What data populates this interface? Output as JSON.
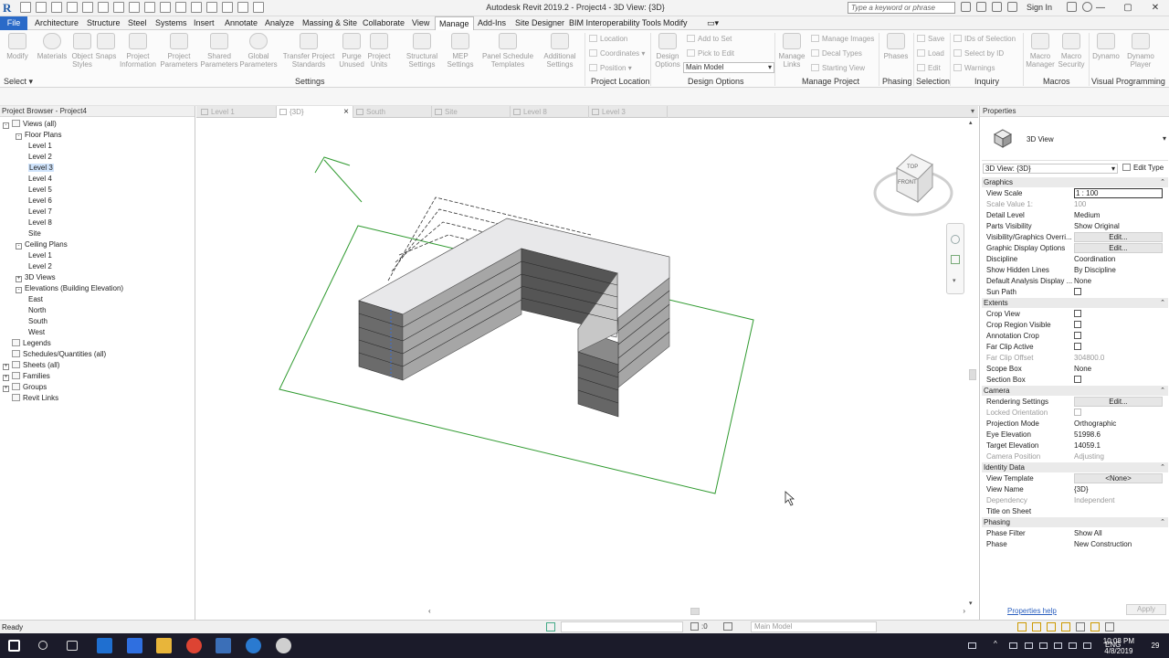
{
  "window": {
    "title": "Autodesk Revit 2019.2 - Project4 - 3D View: {3D}",
    "search_placeholder": "Type a keyword or phrase",
    "sign_in": "Sign In"
  },
  "menu_tabs": [
    "File",
    "Architecture",
    "Structure",
    "Steel",
    "Systems",
    "Insert",
    "Annotate",
    "Analyze",
    "Massing & Site",
    "Collaborate",
    "View",
    "Manage",
    "Add-Ins",
    "Site Designer",
    "BIM Interoperability Tools",
    "Modify"
  ],
  "active_tab": "Manage",
  "ribbon": {
    "select_label": "Select",
    "buttons": [
      {
        "label": "Modify",
        "icon": "cursor-icon"
      },
      {
        "label": "Materials",
        "icon": "sphere-icon"
      },
      {
        "label": "Object Styles",
        "icon": "object-styles-icon"
      },
      {
        "label": "Snaps",
        "icon": "magnet-icon"
      },
      {
        "label": "Project Information",
        "icon": "info-icon"
      },
      {
        "label": "Project Parameters",
        "icon": "parameters-icon"
      },
      {
        "label": "Shared Parameters",
        "icon": "shared-parameters-icon"
      },
      {
        "label": "Global Parameters",
        "icon": "globe-icon"
      },
      {
        "label": "Transfer Project Standards",
        "icon": "transfer-icon"
      },
      {
        "label": "Purge Unused",
        "icon": "purge-icon"
      },
      {
        "label": "Project Units",
        "icon": "units-icon"
      },
      {
        "label": "Structural Settings",
        "icon": "structural-settings-icon"
      },
      {
        "label": "MEP Settings",
        "icon": "mep-settings-icon"
      },
      {
        "label": "Panel Schedule Templates",
        "icon": "panel-schedule-icon"
      },
      {
        "label": "Additional Settings",
        "icon": "wrench-icon"
      },
      {
        "label": "Design Options",
        "icon": "design-options-icon"
      },
      {
        "label": "Manage Links",
        "icon": "links-icon"
      },
      {
        "label": "Phases",
        "icon": "phases-icon"
      },
      {
        "label": "Macro Manager",
        "icon": "macro-manager-icon"
      },
      {
        "label": "Macro Security",
        "icon": "macro-security-icon"
      },
      {
        "label": "Dynamo",
        "icon": "dynamo-icon"
      },
      {
        "label": "Dynamo Player",
        "icon": "dynamo-player-icon"
      }
    ],
    "small_items": {
      "location": [
        "Location",
        "Coordinates",
        "Position"
      ],
      "design_options": [
        "Add to Set",
        "Pick to Edit"
      ],
      "design_option_value": "Main Model",
      "manage_project": [
        "Manage Images",
        "Decal Types",
        "Starting View"
      ],
      "selection": [
        "Save",
        "Load",
        "Edit"
      ],
      "inquiry": [
        "IDs of Selection",
        "Select by ID",
        "Warnings"
      ]
    },
    "panels": [
      "Settings",
      "Project Location",
      "Design Options",
      "Manage Project",
      "Phasing",
      "Selection",
      "Inquiry",
      "Macros",
      "Visual Programming"
    ]
  },
  "project_browser": {
    "title": "Project Browser - Project4",
    "nodes": [
      {
        "label": "Views (all)",
        "level": 0,
        "exp": "-",
        "icon": true
      },
      {
        "label": "Floor Plans",
        "level": 1,
        "exp": "-"
      },
      {
        "label": "Level 1",
        "level": 2
      },
      {
        "label": "Level 2",
        "level": 2
      },
      {
        "label": "Level 3",
        "level": 2,
        "selected": true
      },
      {
        "label": "Level 4",
        "level": 2
      },
      {
        "label": "Level 5",
        "level": 2
      },
      {
        "label": "Level 6",
        "level": 2
      },
      {
        "label": "Level 7",
        "level": 2
      },
      {
        "label": "Level 8",
        "level": 2
      },
      {
        "label": "Site",
        "level": 2
      },
      {
        "label": "Ceiling Plans",
        "level": 1,
        "exp": "-"
      },
      {
        "label": "Level 1",
        "level": 2
      },
      {
        "label": "Level 2",
        "level": 2
      },
      {
        "label": "3D Views",
        "level": 1,
        "exp": "+"
      },
      {
        "label": "Elevations (Building Elevation)",
        "level": 1,
        "exp": "-"
      },
      {
        "label": "East",
        "level": 2
      },
      {
        "label": "North",
        "level": 2
      },
      {
        "label": "South",
        "level": 2
      },
      {
        "label": "West",
        "level": 2
      },
      {
        "label": "Legends",
        "level": 0,
        "icon": true
      },
      {
        "label": "Schedules/Quantities (all)",
        "level": 0,
        "icon": true
      },
      {
        "label": "Sheets (all)",
        "level": 0,
        "exp": "+",
        "icon": true
      },
      {
        "label": "Families",
        "level": 0,
        "exp": "+",
        "icon": true
      },
      {
        "label": "Groups",
        "level": 0,
        "exp": "+",
        "icon": true
      },
      {
        "label": "Revit Links",
        "level": 0,
        "icon": true
      }
    ]
  },
  "view_tabs": [
    {
      "label": "Level 1",
      "active": false
    },
    {
      "label": "{3D}",
      "active": true
    },
    {
      "label": "South",
      "active": false
    },
    {
      "label": "Site",
      "active": false
    },
    {
      "label": "Level 8",
      "active": false
    },
    {
      "label": "Level 3",
      "active": false
    }
  ],
  "viewcube": {
    "top": "TOP",
    "front": "FRONT"
  },
  "properties": {
    "title": "Properties",
    "type_name": "3D View",
    "instance": "3D View: {3D}",
    "edit_type": "Edit Type",
    "help": "Properties help",
    "apply": "Apply",
    "groups": [
      {
        "name": "Graphics",
        "rows": [
          {
            "k": "View Scale",
            "v": "1 : 100",
            "style": "box"
          },
          {
            "k": "Scale Value    1:",
            "v": "100",
            "dim": true
          },
          {
            "k": "Detail Level",
            "v": "Medium"
          },
          {
            "k": "Parts Visibility",
            "v": "Show Original"
          },
          {
            "k": "Visibility/Graphics Overri...",
            "v": "Edit...",
            "style": "btn"
          },
          {
            "k": "Graphic Display Options",
            "v": "Edit...",
            "style": "btn"
          },
          {
            "k": "Discipline",
            "v": "Coordination"
          },
          {
            "k": "Show Hidden Lines",
            "v": "By Discipline"
          },
          {
            "k": "Default Analysis Display ...",
            "v": "None"
          },
          {
            "k": "Sun Path",
            "v": "",
            "check": true
          }
        ]
      },
      {
        "name": "Extents",
        "rows": [
          {
            "k": "Crop View",
            "v": "",
            "check": true
          },
          {
            "k": "Crop Region Visible",
            "v": "",
            "check": true
          },
          {
            "k": "Annotation Crop",
            "v": "",
            "check": true
          },
          {
            "k": "Far Clip Active",
            "v": "",
            "check": true
          },
          {
            "k": "Far Clip Offset",
            "v": "304800.0",
            "dim": true
          },
          {
            "k": "Scope Box",
            "v": "None"
          },
          {
            "k": "Section Box",
            "v": "",
            "check": true
          }
        ]
      },
      {
        "name": "Camera",
        "rows": [
          {
            "k": "Rendering Settings",
            "v": "Edit...",
            "style": "btn"
          },
          {
            "k": "Locked Orientation",
            "v": "",
            "check": true,
            "dim": true
          },
          {
            "k": "Projection Mode",
            "v": "Orthographic"
          },
          {
            "k": "Eye Elevation",
            "v": "51998.6"
          },
          {
            "k": "Target Elevation",
            "v": "14059.1"
          },
          {
            "k": "Camera Position",
            "v": "Adjusting",
            "dim": true
          }
        ]
      },
      {
        "name": "Identity Data",
        "rows": [
          {
            "k": "View Template",
            "v": "<None>",
            "style": "btn"
          },
          {
            "k": "View Name",
            "v": "{3D}"
          },
          {
            "k": "Dependency",
            "v": "Independent",
            "dim": true
          },
          {
            "k": "Title on Sheet",
            "v": ""
          }
        ]
      },
      {
        "name": "Phasing",
        "rows": [
          {
            "k": "Phase Filter",
            "v": "Show All"
          },
          {
            "k": "Phase",
            "v": "New Construction"
          }
        ]
      }
    ]
  },
  "status": {
    "text": "Ready",
    "selection_count": ":0",
    "model": "Main Model"
  },
  "taskbar": {
    "lang": "ENG",
    "time": "10:08 PM",
    "date": "4/8/2019",
    "notifications": "29"
  },
  "colors": {
    "accent": "#2a6ac8",
    "crop_region": "#2f9a2f",
    "mass_dark": "#5f5f5f",
    "mass_light": "#a8a8a8",
    "taskbar": "#1b1b2a"
  }
}
